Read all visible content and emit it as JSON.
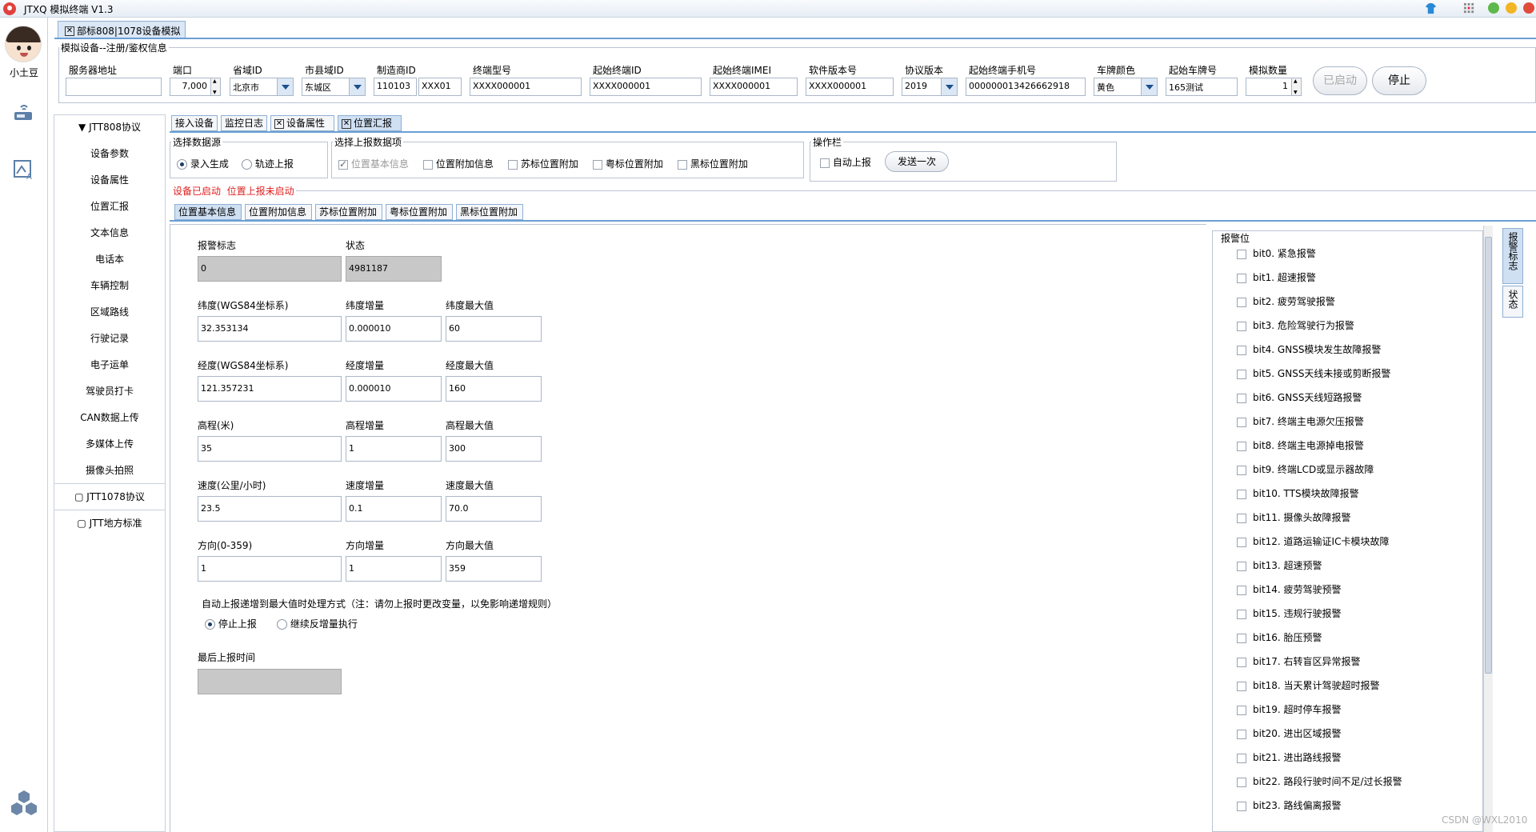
{
  "app": {
    "title": "JTXQ 模拟终端 V1.3"
  },
  "user": {
    "name": "小土豆"
  },
  "main_tab": {
    "label": "部标808|1078设备模拟",
    "close": "✕"
  },
  "config": {
    "group_title": "模拟设备--注册/鉴权信息",
    "fields": {
      "server_address": {
        "label": "服务器地址",
        "value": ""
      },
      "port": {
        "label": "端口",
        "value": "7,000"
      },
      "province_id": {
        "label": "省域ID",
        "value": "北京市"
      },
      "city_id": {
        "label": "市县域ID",
        "value": "东城区"
      },
      "manufacturer_id": {
        "label": "制造商ID",
        "value": "110103",
        "value2": "XXX01"
      },
      "terminal_model": {
        "label": "终端型号",
        "value": "XXXX000001"
      },
      "start_terminal_id": {
        "label": "起始终端ID",
        "value": "XXXX000001"
      },
      "start_imei": {
        "label": "起始终端IMEI",
        "value": "XXXX000001"
      },
      "software_version": {
        "label": "软件版本号",
        "value": "XXXX000001"
      },
      "protocol_version": {
        "label": "协议版本",
        "value": "2019"
      },
      "start_phone": {
        "label": "起始终端手机号",
        "value": "000000013426662918"
      },
      "plate_color": {
        "label": "车牌颜色",
        "value": "黄色"
      },
      "start_plate": {
        "label": "起始车牌号",
        "value": "165测试"
      },
      "sim_count": {
        "label": "模拟数量",
        "value": "1"
      }
    },
    "start_button": "已启动",
    "stop_button": "停止"
  },
  "nav": {
    "groups": [
      {
        "label": "▼ JTT808协议"
      },
      {
        "label": "▢ JTT1078协议"
      },
      {
        "label": "▢ JTT地方标准"
      }
    ],
    "items": [
      "设备参数",
      "设备属性",
      "位置汇报",
      "文本信息",
      "电话本",
      "车辆控制",
      "区域路线",
      "行驶记录",
      "电子运单",
      "驾驶员打卡",
      "CAN数据上传",
      "多媒体上传",
      "摄像头拍照"
    ]
  },
  "sub_tabs": [
    {
      "label": "接入设备",
      "closable": false
    },
    {
      "label": "监控日志",
      "closable": false
    },
    {
      "label": "设备属性",
      "closable": true
    },
    {
      "label": "位置汇报",
      "closable": true
    }
  ],
  "data_source": {
    "title": "选择数据源",
    "options": [
      "录入生成",
      "轨迹上报"
    ],
    "selected": "录入生成"
  },
  "report_items": {
    "title": "选择上报数据项",
    "items": [
      {
        "label": "位置基本信息",
        "checked": true,
        "disabled": true
      },
      {
        "label": "位置附加信息",
        "checked": false
      },
      {
        "label": "苏标位置附加",
        "checked": false
      },
      {
        "label": "粤标位置附加",
        "checked": false
      },
      {
        "label": "黑标位置附加",
        "checked": false
      }
    ]
  },
  "ops": {
    "title": "操作栏",
    "auto_report": "自动上报",
    "send_once": "发送一次"
  },
  "status_line": {
    "device": "设备已启动",
    "report": "位置上报未启动"
  },
  "info_tabs": [
    "位置基本信息",
    "位置附加信息",
    "苏标位置附加",
    "粤标位置附加",
    "黑标位置附加"
  ],
  "basic_info": {
    "alarm_flag": {
      "label": "报警标志",
      "value": "0"
    },
    "status": {
      "label": "状态",
      "value": "4981187"
    },
    "rows": [
      {
        "l1": "纬度(WGS84坐标系)",
        "v1": "32.353134",
        "l2": "纬度增量",
        "v2": "0.000010",
        "l3": "纬度最大值",
        "v3": "60"
      },
      {
        "l1": "经度(WGS84坐标系)",
        "v1": "121.357231",
        "l2": "经度增量",
        "v2": "0.000010",
        "l3": "经度最大值",
        "v3": "160"
      },
      {
        "l1": "高程(米)",
        "v1": "35",
        "l2": "高程增量",
        "v2": "1",
        "l3": "高程最大值",
        "v3": "300"
      },
      {
        "l1": "速度(公里/小时)",
        "v1": "23.5",
        "l2": "速度增量",
        "v2": "0.1",
        "l3": "速度最大值",
        "v3": "70.0"
      },
      {
        "l1": "方向(0-359)",
        "v1": "1",
        "l2": "方向增量",
        "v2": "1",
        "l3": "方向最大值",
        "v3": "359"
      }
    ],
    "auto_note": "自动上报递增到最大值时处理方式（注：请勿上报时更改变量，以免影响递增规则）",
    "max_options": [
      "停止上报",
      "继续反增量执行"
    ],
    "max_selected": "停止上报",
    "last_report_label": "最后上报时间",
    "last_report_value": ""
  },
  "alarm_bits": {
    "title": "报警位",
    "items": [
      "bit0. 紧急报警",
      "bit1. 超速报警",
      "bit2. 疲劳驾驶报警",
      "bit3. 危险驾驶行为报警",
      "bit4. GNSS模块发生故障报警",
      "bit5. GNSS天线未接或剪断报警",
      "bit6. GNSS天线短路报警",
      "bit7. 终端主电源欠压报警",
      "bit8. 终端主电源掉电报警",
      "bit9. 终端LCD或显示器故障",
      "bit10. TTS模块故障报警",
      "bit11. 摄像头故障报警",
      "bit12. 道路运输证IC卡模块故障",
      "bit13. 超速预警",
      "bit14. 疲劳驾驶预警",
      "bit15. 违规行驶报警",
      "bit16. 胎压预警",
      "bit17. 右转盲区异常报警",
      "bit18. 当天累计驾驶超时报警",
      "bit19. 超时停车报警",
      "bit20. 进出区域报警",
      "bit21. 进出路线报警",
      "bit22. 路段行驶时间不足/过长报警",
      "bit23. 路线偏离报警"
    ]
  },
  "vertical_tabs": [
    "报警标志",
    "状态"
  ],
  "watermark": "CSDN @WXL2010"
}
